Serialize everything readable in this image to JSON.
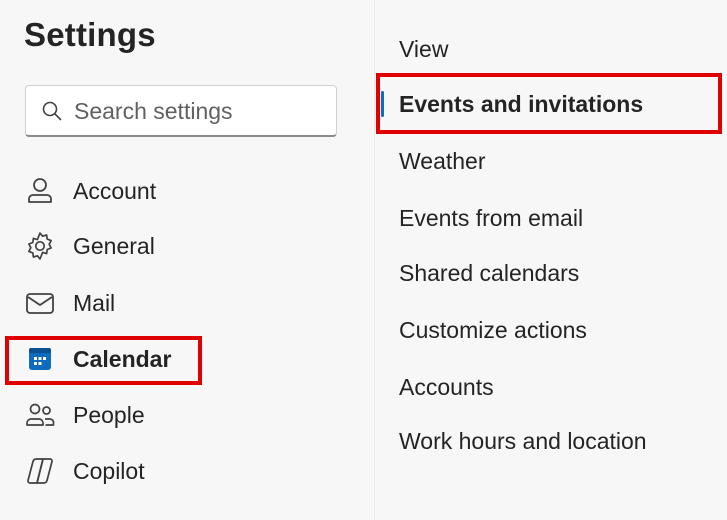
{
  "settings": {
    "title": "Settings",
    "search": {
      "placeholder": "Search settings",
      "value": ""
    }
  },
  "nav": {
    "items": [
      {
        "label": "Account",
        "icon": "person-icon"
      },
      {
        "label": "General",
        "icon": "gear-icon"
      },
      {
        "label": "Mail",
        "icon": "mail-icon"
      },
      {
        "label": "Calendar",
        "icon": "calendar-icon",
        "active": true
      },
      {
        "label": "People",
        "icon": "people-icon"
      },
      {
        "label": "Copilot",
        "icon": "copilot-icon"
      }
    ]
  },
  "calendar_settings": {
    "items": [
      {
        "label": "View"
      },
      {
        "label": "Events and invitations",
        "active": true
      },
      {
        "label": "Weather"
      },
      {
        "label": "Events from email"
      },
      {
        "label": "Shared calendars"
      },
      {
        "label": "Customize actions"
      },
      {
        "label": "Accounts"
      },
      {
        "label": "Work hours and location"
      }
    ]
  },
  "colors": {
    "accent": "#0f6cbd",
    "highlight_box": "#e00000",
    "pane_background": "#f7f7f7"
  }
}
